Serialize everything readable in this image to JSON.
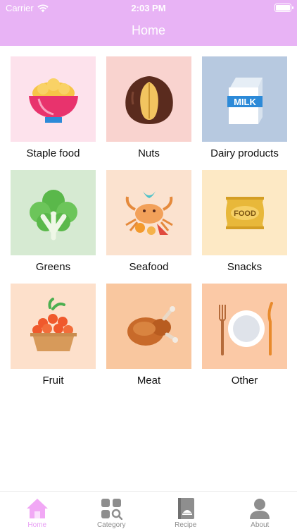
{
  "status_bar": {
    "carrier": "Carrier",
    "time": "2:03 PM"
  },
  "header": {
    "title": "Home"
  },
  "colors": {
    "accent": "#e8b3f5",
    "tab_active": "#e89ff5",
    "tab_inactive": "#8e8e8e"
  },
  "categories": [
    {
      "label": "Staple food",
      "icon": "rice-bowl-icon",
      "bg": "#fde2ec"
    },
    {
      "label": "Nuts",
      "icon": "nut-icon",
      "bg": "#f9d3cf"
    },
    {
      "label": "Dairy products",
      "icon": "milk-carton-icon",
      "bg": "#b7c9e0"
    },
    {
      "label": "Greens",
      "icon": "greens-icon",
      "bg": "#d6ead2"
    },
    {
      "label": "Seafood",
      "icon": "crab-icon",
      "bg": "#fbe2cf"
    },
    {
      "label": "Snacks",
      "icon": "snack-bag-icon",
      "bg": "#fde9c5"
    },
    {
      "label": "Fruit",
      "icon": "fruit-basket-icon",
      "bg": "#fde0cb"
    },
    {
      "label": "Meat",
      "icon": "roast-chicken-icon",
      "bg": "#f9c79f"
    },
    {
      "label": "Other",
      "icon": "plate-cutlery-icon",
      "bg": "#fbc9a6"
    }
  ],
  "icon_texts": {
    "milk": "MILK",
    "food": "FOOD"
  },
  "tabs": [
    {
      "label": "Home",
      "icon": "home-icon",
      "active": true
    },
    {
      "label": "Category",
      "icon": "category-grid-icon",
      "active": false
    },
    {
      "label": "Recipe",
      "icon": "recipe-book-icon",
      "active": false
    },
    {
      "label": "About",
      "icon": "person-icon",
      "active": false
    }
  ]
}
